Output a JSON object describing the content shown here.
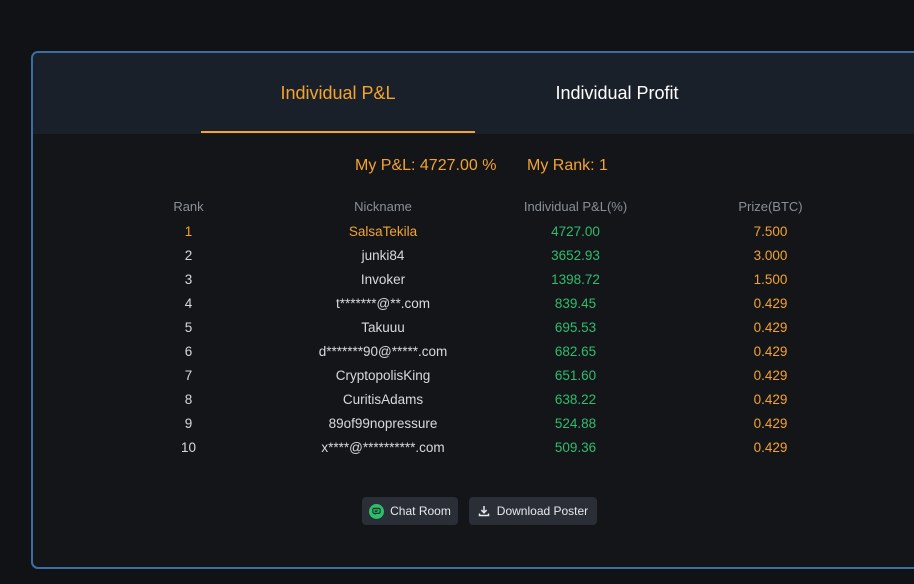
{
  "tabs": [
    {
      "label": "Individual P&L",
      "active": true
    },
    {
      "label": "Individual Profit",
      "active": false
    }
  ],
  "summary": {
    "my_pnl": "My P&L: 4727.00 %",
    "my_rank": "My Rank: 1"
  },
  "table": {
    "headers": [
      "Rank",
      "Nickname",
      "Individual P&L(%)",
      "Prize(BTC)"
    ],
    "rows": [
      {
        "rank": "1",
        "nickname": "SalsaTekila",
        "pnl": "4727.00",
        "prize": "7.500"
      },
      {
        "rank": "2",
        "nickname": "junki84",
        "pnl": "3652.93",
        "prize": "3.000"
      },
      {
        "rank": "3",
        "nickname": "Invoker",
        "pnl": "1398.72",
        "prize": "1.500"
      },
      {
        "rank": "4",
        "nickname": "t*******@**.com",
        "pnl": "839.45",
        "prize": "0.429"
      },
      {
        "rank": "5",
        "nickname": "Takuuu",
        "pnl": "695.53",
        "prize": "0.429"
      },
      {
        "rank": "6",
        "nickname": "d*******90@*****.com",
        "pnl": "682.65",
        "prize": "0.429"
      },
      {
        "rank": "7",
        "nickname": "CryptopolisKing",
        "pnl": "651.60",
        "prize": "0.429"
      },
      {
        "rank": "8",
        "nickname": "CuritisAdams",
        "pnl": "638.22",
        "prize": "0.429"
      },
      {
        "rank": "9",
        "nickname": "89of99nopressure",
        "pnl": "524.88",
        "prize": "0.429"
      },
      {
        "rank": "10",
        "nickname": "x****@**********.com",
        "pnl": "509.36",
        "prize": "0.429"
      }
    ]
  },
  "buttons": {
    "chat_label": "Chat Room",
    "download_label": "Download Poster"
  },
  "colors": {
    "accent": "#f3a330",
    "positive": "#2fbd6e",
    "border": "#3b6fa3"
  },
  "icons": {
    "chat": "chat-bubble-icon",
    "download": "download-icon"
  }
}
